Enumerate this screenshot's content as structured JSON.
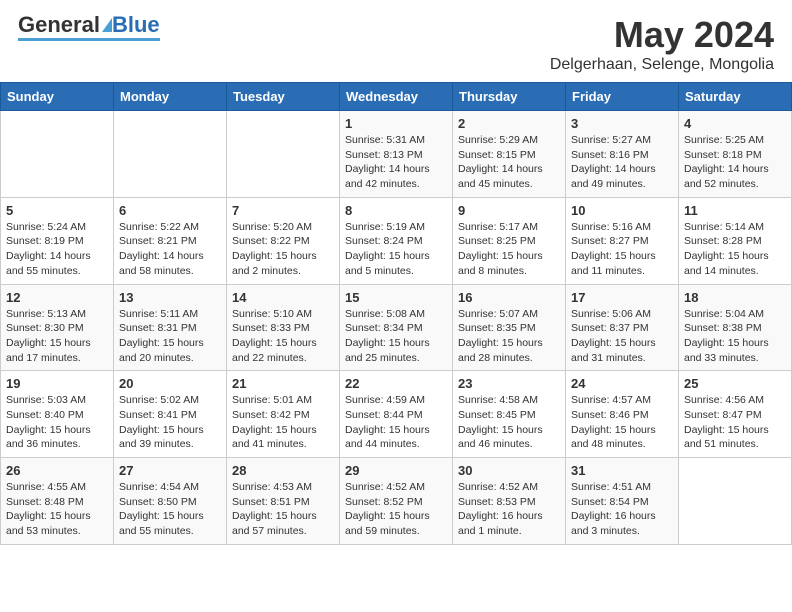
{
  "header": {
    "logo_general": "General",
    "logo_blue": "Blue",
    "month_title": "May 2024",
    "location": "Delgerhaan, Selenge, Mongolia"
  },
  "days_of_week": [
    "Sunday",
    "Monday",
    "Tuesday",
    "Wednesday",
    "Thursday",
    "Friday",
    "Saturday"
  ],
  "weeks": [
    [
      {
        "day": "",
        "sunrise": "",
        "sunset": "",
        "daylight": ""
      },
      {
        "day": "",
        "sunrise": "",
        "sunset": "",
        "daylight": ""
      },
      {
        "day": "",
        "sunrise": "",
        "sunset": "",
        "daylight": ""
      },
      {
        "day": "1",
        "sunrise": "5:31 AM",
        "sunset": "8:13 PM",
        "daylight": "14 hours and 42 minutes."
      },
      {
        "day": "2",
        "sunrise": "5:29 AM",
        "sunset": "8:15 PM",
        "daylight": "14 hours and 45 minutes."
      },
      {
        "day": "3",
        "sunrise": "5:27 AM",
        "sunset": "8:16 PM",
        "daylight": "14 hours and 49 minutes."
      },
      {
        "day": "4",
        "sunrise": "5:25 AM",
        "sunset": "8:18 PM",
        "daylight": "14 hours and 52 minutes."
      }
    ],
    [
      {
        "day": "5",
        "sunrise": "5:24 AM",
        "sunset": "8:19 PM",
        "daylight": "14 hours and 55 minutes."
      },
      {
        "day": "6",
        "sunrise": "5:22 AM",
        "sunset": "8:21 PM",
        "daylight": "14 hours and 58 minutes."
      },
      {
        "day": "7",
        "sunrise": "5:20 AM",
        "sunset": "8:22 PM",
        "daylight": "15 hours and 2 minutes."
      },
      {
        "day": "8",
        "sunrise": "5:19 AM",
        "sunset": "8:24 PM",
        "daylight": "15 hours and 5 minutes."
      },
      {
        "day": "9",
        "sunrise": "5:17 AM",
        "sunset": "8:25 PM",
        "daylight": "15 hours and 8 minutes."
      },
      {
        "day": "10",
        "sunrise": "5:16 AM",
        "sunset": "8:27 PM",
        "daylight": "15 hours and 11 minutes."
      },
      {
        "day": "11",
        "sunrise": "5:14 AM",
        "sunset": "8:28 PM",
        "daylight": "15 hours and 14 minutes."
      }
    ],
    [
      {
        "day": "12",
        "sunrise": "5:13 AM",
        "sunset": "8:30 PM",
        "daylight": "15 hours and 17 minutes."
      },
      {
        "day": "13",
        "sunrise": "5:11 AM",
        "sunset": "8:31 PM",
        "daylight": "15 hours and 20 minutes."
      },
      {
        "day": "14",
        "sunrise": "5:10 AM",
        "sunset": "8:33 PM",
        "daylight": "15 hours and 22 minutes."
      },
      {
        "day": "15",
        "sunrise": "5:08 AM",
        "sunset": "8:34 PM",
        "daylight": "15 hours and 25 minutes."
      },
      {
        "day": "16",
        "sunrise": "5:07 AM",
        "sunset": "8:35 PM",
        "daylight": "15 hours and 28 minutes."
      },
      {
        "day": "17",
        "sunrise": "5:06 AM",
        "sunset": "8:37 PM",
        "daylight": "15 hours and 31 minutes."
      },
      {
        "day": "18",
        "sunrise": "5:04 AM",
        "sunset": "8:38 PM",
        "daylight": "15 hours and 33 minutes."
      }
    ],
    [
      {
        "day": "19",
        "sunrise": "5:03 AM",
        "sunset": "8:40 PM",
        "daylight": "15 hours and 36 minutes."
      },
      {
        "day": "20",
        "sunrise": "5:02 AM",
        "sunset": "8:41 PM",
        "daylight": "15 hours and 39 minutes."
      },
      {
        "day": "21",
        "sunrise": "5:01 AM",
        "sunset": "8:42 PM",
        "daylight": "15 hours and 41 minutes."
      },
      {
        "day": "22",
        "sunrise": "4:59 AM",
        "sunset": "8:44 PM",
        "daylight": "15 hours and 44 minutes."
      },
      {
        "day": "23",
        "sunrise": "4:58 AM",
        "sunset": "8:45 PM",
        "daylight": "15 hours and 46 minutes."
      },
      {
        "day": "24",
        "sunrise": "4:57 AM",
        "sunset": "8:46 PM",
        "daylight": "15 hours and 48 minutes."
      },
      {
        "day": "25",
        "sunrise": "4:56 AM",
        "sunset": "8:47 PM",
        "daylight": "15 hours and 51 minutes."
      }
    ],
    [
      {
        "day": "26",
        "sunrise": "4:55 AM",
        "sunset": "8:48 PM",
        "daylight": "15 hours and 53 minutes."
      },
      {
        "day": "27",
        "sunrise": "4:54 AM",
        "sunset": "8:50 PM",
        "daylight": "15 hours and 55 minutes."
      },
      {
        "day": "28",
        "sunrise": "4:53 AM",
        "sunset": "8:51 PM",
        "daylight": "15 hours and 57 minutes."
      },
      {
        "day": "29",
        "sunrise": "4:52 AM",
        "sunset": "8:52 PM",
        "daylight": "15 hours and 59 minutes."
      },
      {
        "day": "30",
        "sunrise": "4:52 AM",
        "sunset": "8:53 PM",
        "daylight": "16 hours and 1 minute."
      },
      {
        "day": "31",
        "sunrise": "4:51 AM",
        "sunset": "8:54 PM",
        "daylight": "16 hours and 3 minutes."
      },
      {
        "day": "",
        "sunrise": "",
        "sunset": "",
        "daylight": ""
      }
    ]
  ],
  "labels": {
    "sunrise_prefix": "Sunrise: ",
    "sunset_prefix": "Sunset: ",
    "daylight_prefix": "Daylight: "
  }
}
